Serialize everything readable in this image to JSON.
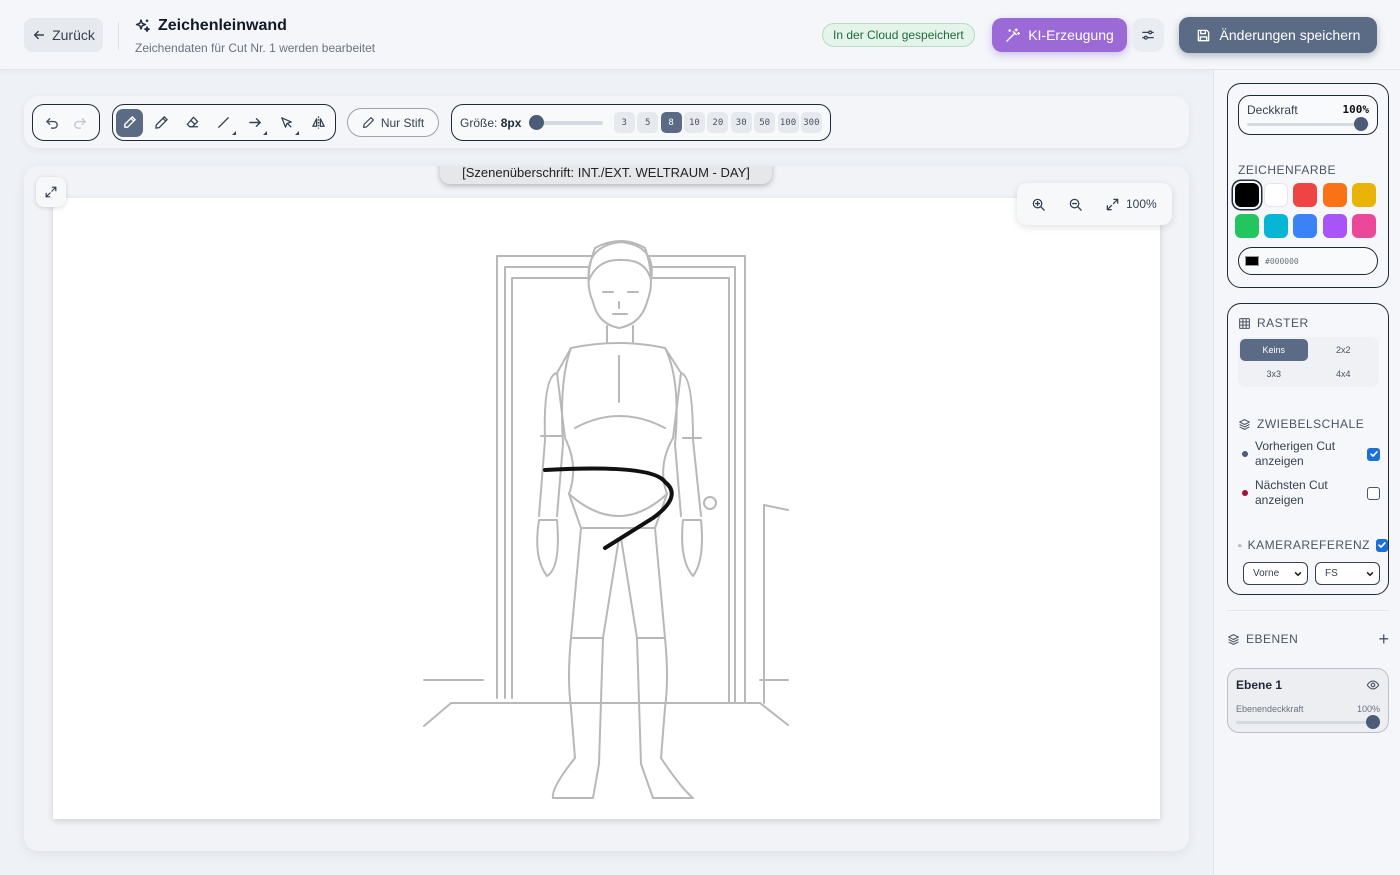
{
  "header": {
    "back_label": "Zurück",
    "title": "Zeichenleinwand",
    "subtitle": "Zeichendaten für Cut Nr. 1 werden bearbeitet",
    "cloud_status": "In der Cloud gespeichert",
    "ai_label": "KI-Erzeugung",
    "save_label": "Änderungen speichern"
  },
  "toolbar": {
    "tools": [
      "undo-icon",
      "redo-icon",
      "brush-icon",
      "pencil-icon",
      "eraser-icon",
      "line-icon",
      "arrow-icon",
      "select-icon",
      "mirror-icon"
    ],
    "active_tool": "brush-icon",
    "pen_only_label": "Nur Stift",
    "size_label": "Größe:",
    "size_value": "8px",
    "size_presets": [
      "3",
      "5",
      "8",
      "10",
      "20",
      "30",
      "50",
      "100",
      "300"
    ],
    "active_preset": "8"
  },
  "canvas": {
    "scene_heading": "[Szenenüberschrift: INT./EXT. WELTRAUM - DAY]",
    "zoom": "100%"
  },
  "sidebar": {
    "opacity_label": "Deckkraft",
    "opacity_value": "100%",
    "color_heading": "ZEICHENFARBE",
    "colors": [
      "#000000",
      "#ffffff",
      "#ef4444",
      "#f97316",
      "#eab308",
      "#22c55e",
      "#06b6d4",
      "#3b82f6",
      "#a855f7",
      "#ec4899"
    ],
    "current_color": "#000000",
    "grid_heading": "RASTER",
    "grid_options": [
      "Keins",
      "2x2",
      "3x3",
      "4x4"
    ],
    "grid_active": "Keins",
    "onion_heading": "ZWIEBELSCHALE",
    "onion_prev": "Vorherigen Cut anzeigen",
    "onion_next": "Nächsten Cut anzeigen",
    "onion_prev_color": "#4b5b78",
    "onion_next_color": "#9f1239",
    "camera_heading": "KAMERAREFERENZ",
    "camera_view": "Vorne",
    "camera_shot": "FS",
    "layers_heading": "EBENEN",
    "layer_name": "Ebene 1",
    "layer_opacity_label": "Ebenendeckkraft",
    "layer_opacity_value": "100%"
  }
}
